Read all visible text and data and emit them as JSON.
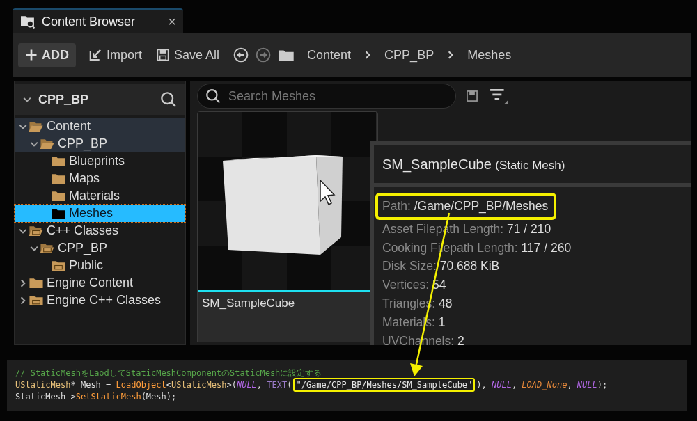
{
  "tab": {
    "label": "Content Browser",
    "selected": true,
    "close": "×"
  },
  "toolbar": {
    "add": "ADD",
    "import": "Import",
    "save_all": "Save All",
    "breadcrumb": [
      "Content",
      "CPP_BP",
      "Meshes"
    ]
  },
  "sidebar": {
    "title": "CPP_BP",
    "tree": [
      {
        "label": "Content",
        "kind": "folder",
        "expanded": true,
        "selected": false,
        "children": [
          {
            "label": "CPP_BP",
            "kind": "folder",
            "expanded": true,
            "selected": false,
            "children": [
              {
                "label": "Blueprints",
                "kind": "folder",
                "selected": false
              },
              {
                "label": "Maps",
                "kind": "folder",
                "selected": false
              },
              {
                "label": "Materials",
                "kind": "folder",
                "selected": false
              },
              {
                "label": "Meshes",
                "kind": "folder",
                "selected": true
              }
            ]
          }
        ]
      },
      {
        "label": "C++ Classes",
        "kind": "cpp_folder",
        "expanded": true,
        "selected": false,
        "children": [
          {
            "label": "CPP_BP",
            "kind": "cpp_folder",
            "expanded": true,
            "selected": false,
            "children": [
              {
                "label": "Public",
                "kind": "cpp_folder",
                "selected": false
              }
            ]
          }
        ]
      },
      {
        "label": "Engine Content",
        "kind": "folder",
        "expanded": false,
        "selected": false
      },
      {
        "label": "Engine C++ Classes",
        "kind": "cpp_folder",
        "expanded": false,
        "selected": false
      }
    ]
  },
  "search": {
    "placeholder": "Search Meshes"
  },
  "asset": {
    "name": "SM_SampleCube",
    "selected": true
  },
  "tooltip": {
    "title": "SM_SampleCube",
    "subtitle": "(Static Mesh)",
    "properties": [
      {
        "label": "Path:",
        "value": "/Game/CPP_BP/Meshes",
        "highlighted": true
      },
      {
        "label": "Asset Filepath Length:",
        "value": "71 / 210",
        "highlighted": false
      },
      {
        "label": "Cooking Filepath Length:",
        "value": "117 / 260",
        "highlighted": false
      },
      {
        "label": "Disk Size:",
        "value": "70.688 KiB",
        "highlighted": false
      },
      {
        "label": "Vertices:",
        "value": "54",
        "highlighted": false
      },
      {
        "label": "Triangles:",
        "value": "48",
        "highlighted": false
      },
      {
        "label": "Materials:",
        "value": "1",
        "highlighted": false
      },
      {
        "label": "UVChannels:",
        "value": "2",
        "highlighted": false
      }
    ]
  },
  "code": [
    [
      {
        "text": "// StaticMeshをLaodしてStaticMeshComponentのStaticMeshに設定する",
        "kind": "comment"
      }
    ],
    [
      {
        "text": "UStaticMesh",
        "kind": "type"
      },
      {
        "text": "* Mesh = ",
        "kind": "plain"
      },
      {
        "text": "LoadObject",
        "kind": "func"
      },
      {
        "text": "<",
        "kind": "plain"
      },
      {
        "text": "UStaticMesh",
        "kind": "type"
      },
      {
        "text": ">(",
        "kind": "plain"
      },
      {
        "text": "NULL",
        "kind": "macro"
      },
      {
        "text": ", ",
        "kind": "plain"
      },
      {
        "text": "TEXT",
        "kind": "keyword"
      },
      {
        "text": "(",
        "kind": "plain"
      },
      {
        "text": "\"/Game/CPP_BP/Meshes/SM_SampleCube\"",
        "kind": "string",
        "highlighted": true
      },
      {
        "text": "), ",
        "kind": "plain"
      },
      {
        "text": "NULL",
        "kind": "macro"
      },
      {
        "text": ", ",
        "kind": "plain"
      },
      {
        "text": "LOAD_None",
        "kind": "enum"
      },
      {
        "text": ", ",
        "kind": "plain"
      },
      {
        "text": "NULL",
        "kind": "macro"
      },
      {
        "text": ");",
        "kind": "plain"
      }
    ],
    [
      {
        "text": "StaticMesh->",
        "kind": "plain"
      },
      {
        "text": "SetStaticMesh",
        "kind": "func"
      },
      {
        "text": "(Mesh);",
        "kind": "plain"
      }
    ]
  ]
}
